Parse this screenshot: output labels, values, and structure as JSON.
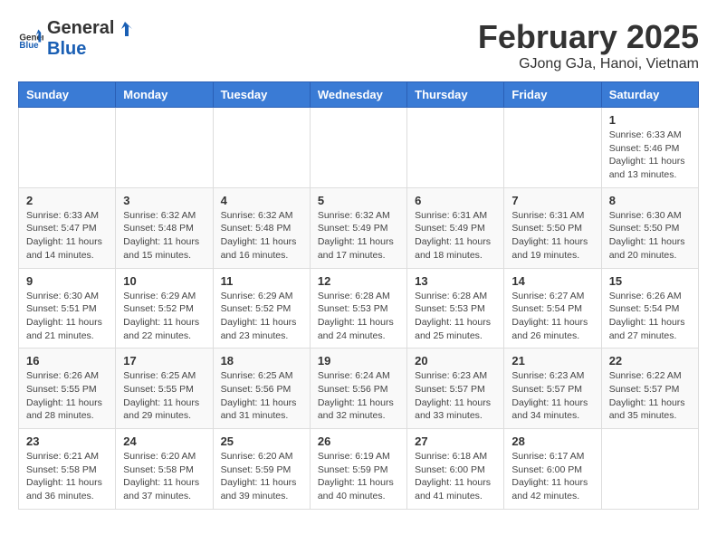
{
  "logo": {
    "text_general": "General",
    "text_blue": "Blue"
  },
  "header": {
    "month_year": "February 2025",
    "location": "GJong GJa, Hanoi, Vietnam"
  },
  "weekdays": [
    "Sunday",
    "Monday",
    "Tuesday",
    "Wednesday",
    "Thursday",
    "Friday",
    "Saturday"
  ],
  "weeks": [
    [
      {
        "day": "",
        "info": ""
      },
      {
        "day": "",
        "info": ""
      },
      {
        "day": "",
        "info": ""
      },
      {
        "day": "",
        "info": ""
      },
      {
        "day": "",
        "info": ""
      },
      {
        "day": "",
        "info": ""
      },
      {
        "day": "1",
        "info": "Sunrise: 6:33 AM\nSunset: 5:46 PM\nDaylight: 11 hours\nand 13 minutes."
      }
    ],
    [
      {
        "day": "2",
        "info": "Sunrise: 6:33 AM\nSunset: 5:47 PM\nDaylight: 11 hours\nand 14 minutes."
      },
      {
        "day": "3",
        "info": "Sunrise: 6:32 AM\nSunset: 5:48 PM\nDaylight: 11 hours\nand 15 minutes."
      },
      {
        "day": "4",
        "info": "Sunrise: 6:32 AM\nSunset: 5:48 PM\nDaylight: 11 hours\nand 16 minutes."
      },
      {
        "day": "5",
        "info": "Sunrise: 6:32 AM\nSunset: 5:49 PM\nDaylight: 11 hours\nand 17 minutes."
      },
      {
        "day": "6",
        "info": "Sunrise: 6:31 AM\nSunset: 5:49 PM\nDaylight: 11 hours\nand 18 minutes."
      },
      {
        "day": "7",
        "info": "Sunrise: 6:31 AM\nSunset: 5:50 PM\nDaylight: 11 hours\nand 19 minutes."
      },
      {
        "day": "8",
        "info": "Sunrise: 6:30 AM\nSunset: 5:50 PM\nDaylight: 11 hours\nand 20 minutes."
      }
    ],
    [
      {
        "day": "9",
        "info": "Sunrise: 6:30 AM\nSunset: 5:51 PM\nDaylight: 11 hours\nand 21 minutes."
      },
      {
        "day": "10",
        "info": "Sunrise: 6:29 AM\nSunset: 5:52 PM\nDaylight: 11 hours\nand 22 minutes."
      },
      {
        "day": "11",
        "info": "Sunrise: 6:29 AM\nSunset: 5:52 PM\nDaylight: 11 hours\nand 23 minutes."
      },
      {
        "day": "12",
        "info": "Sunrise: 6:28 AM\nSunset: 5:53 PM\nDaylight: 11 hours\nand 24 minutes."
      },
      {
        "day": "13",
        "info": "Sunrise: 6:28 AM\nSunset: 5:53 PM\nDaylight: 11 hours\nand 25 minutes."
      },
      {
        "day": "14",
        "info": "Sunrise: 6:27 AM\nSunset: 5:54 PM\nDaylight: 11 hours\nand 26 minutes."
      },
      {
        "day": "15",
        "info": "Sunrise: 6:26 AM\nSunset: 5:54 PM\nDaylight: 11 hours\nand 27 minutes."
      }
    ],
    [
      {
        "day": "16",
        "info": "Sunrise: 6:26 AM\nSunset: 5:55 PM\nDaylight: 11 hours\nand 28 minutes."
      },
      {
        "day": "17",
        "info": "Sunrise: 6:25 AM\nSunset: 5:55 PM\nDaylight: 11 hours\nand 29 minutes."
      },
      {
        "day": "18",
        "info": "Sunrise: 6:25 AM\nSunset: 5:56 PM\nDaylight: 11 hours\nand 31 minutes."
      },
      {
        "day": "19",
        "info": "Sunrise: 6:24 AM\nSunset: 5:56 PM\nDaylight: 11 hours\nand 32 minutes."
      },
      {
        "day": "20",
        "info": "Sunrise: 6:23 AM\nSunset: 5:57 PM\nDaylight: 11 hours\nand 33 minutes."
      },
      {
        "day": "21",
        "info": "Sunrise: 6:23 AM\nSunset: 5:57 PM\nDaylight: 11 hours\nand 34 minutes."
      },
      {
        "day": "22",
        "info": "Sunrise: 6:22 AM\nSunset: 5:57 PM\nDaylight: 11 hours\nand 35 minutes."
      }
    ],
    [
      {
        "day": "23",
        "info": "Sunrise: 6:21 AM\nSunset: 5:58 PM\nDaylight: 11 hours\nand 36 minutes."
      },
      {
        "day": "24",
        "info": "Sunrise: 6:20 AM\nSunset: 5:58 PM\nDaylight: 11 hours\nand 37 minutes."
      },
      {
        "day": "25",
        "info": "Sunrise: 6:20 AM\nSunset: 5:59 PM\nDaylight: 11 hours\nand 39 minutes."
      },
      {
        "day": "26",
        "info": "Sunrise: 6:19 AM\nSunset: 5:59 PM\nDaylight: 11 hours\nand 40 minutes."
      },
      {
        "day": "27",
        "info": "Sunrise: 6:18 AM\nSunset: 6:00 PM\nDaylight: 11 hours\nand 41 minutes."
      },
      {
        "day": "28",
        "info": "Sunrise: 6:17 AM\nSunset: 6:00 PM\nDaylight: 11 hours\nand 42 minutes."
      },
      {
        "day": "",
        "info": ""
      }
    ]
  ]
}
